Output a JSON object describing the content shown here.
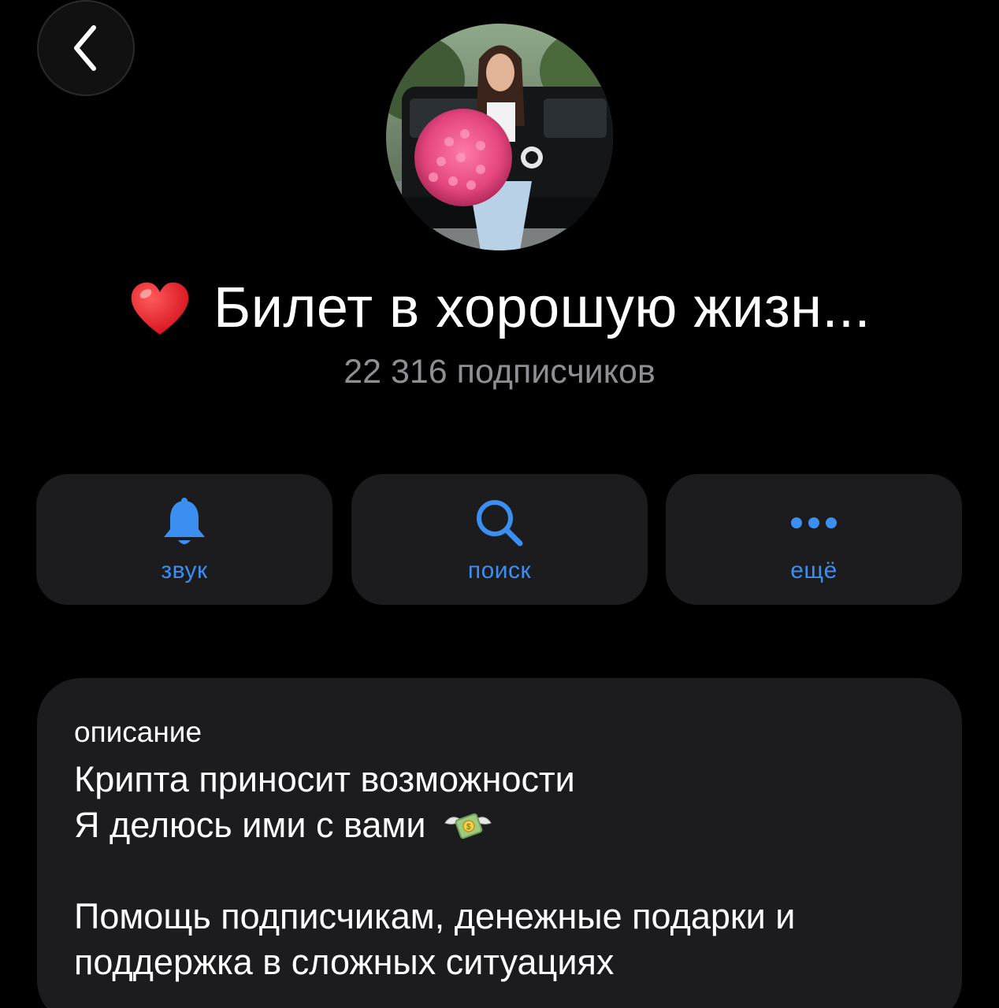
{
  "header": {
    "back_icon": "chevron-left-icon"
  },
  "channel": {
    "avatar_icon": "channel-avatar",
    "title_emoji": "heart-emoji",
    "title": "Билет в хорошую жизн...",
    "subscribers": "22 316 подписчиков"
  },
  "actions": [
    {
      "label": "звук",
      "icon": "bell-icon"
    },
    {
      "label": "поиск",
      "icon": "search-icon"
    },
    {
      "label": "ещё",
      "icon": "more-icon"
    }
  ],
  "description": {
    "caption": "описание",
    "line1": "Крипта приносит возможности",
    "line2": "Я делюсь ими с вами",
    "line2_emoji": "money-with-wings-emoji",
    "line3": "Помощь подписчикам, денежные подарки и поддержка в сложных ситуациях"
  },
  "colors": {
    "background": "#000000",
    "card": "#1c1c1e",
    "accent": "#3a8ff0",
    "secondary_text": "#8e8e93"
  }
}
